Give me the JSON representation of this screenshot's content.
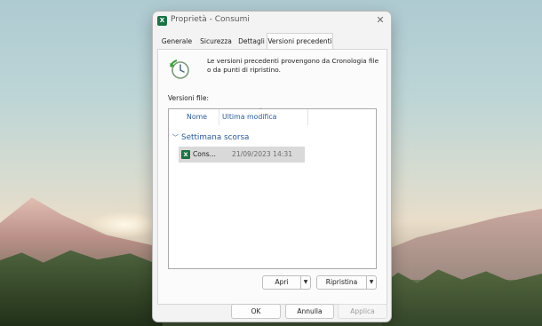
{
  "window": {
    "title": "Proprietà - Consumi",
    "close_label": "✕"
  },
  "tabs": [
    {
      "label": "Generale"
    },
    {
      "label": "Sicurezza"
    },
    {
      "label": "Dettagli"
    },
    {
      "label": "Versioni precedenti",
      "active": true
    }
  ],
  "panel": {
    "description": "Le versioni precedenti provengono da Cronologia file o da punti di ripristino.",
    "versions_label": "Versioni file:",
    "columns": [
      "Nome",
      "Ultima modifica"
    ],
    "group": "Settimana scorsa",
    "files": [
      {
        "name": "Cons...",
        "modified": "21/09/2023 14:31",
        "icon": "excel-file-icon"
      }
    ],
    "open_button": "Apri",
    "restore_button": "Ripristina"
  },
  "footer": {
    "ok": "OK",
    "cancel": "Annulla",
    "apply": "Applica"
  },
  "colors": {
    "accent_text": "#2a5a97",
    "excel_green": "#1e7145"
  }
}
